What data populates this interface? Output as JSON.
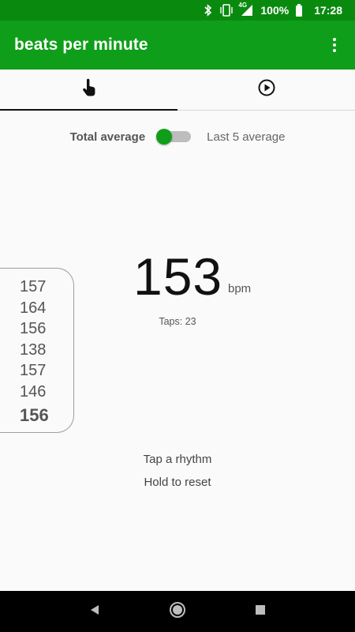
{
  "status_bar": {
    "network": "4G",
    "battery": "100%",
    "time": "17:28"
  },
  "app_bar": {
    "title": "beats per minute"
  },
  "tabs": [
    {
      "icon": "tap-hand-icon",
      "active": true
    },
    {
      "icon": "play-circle-icon",
      "active": false
    }
  ],
  "average_toggle": {
    "left_label": "Total average",
    "right_label": "Last 5 average",
    "on": true,
    "color": "#0f9e19"
  },
  "history": {
    "values": [
      "157",
      "164",
      "156",
      "138",
      "157",
      "146"
    ],
    "latest": "156"
  },
  "bpm": {
    "value": "153",
    "unit": "bpm",
    "taps_text": "Taps: 23"
  },
  "hints": {
    "line1": "Tap a rhythm",
    "line2": "Hold to reset"
  },
  "colors": {
    "status_bar": "#098a0f",
    "app_bar": "#0f9e19"
  }
}
